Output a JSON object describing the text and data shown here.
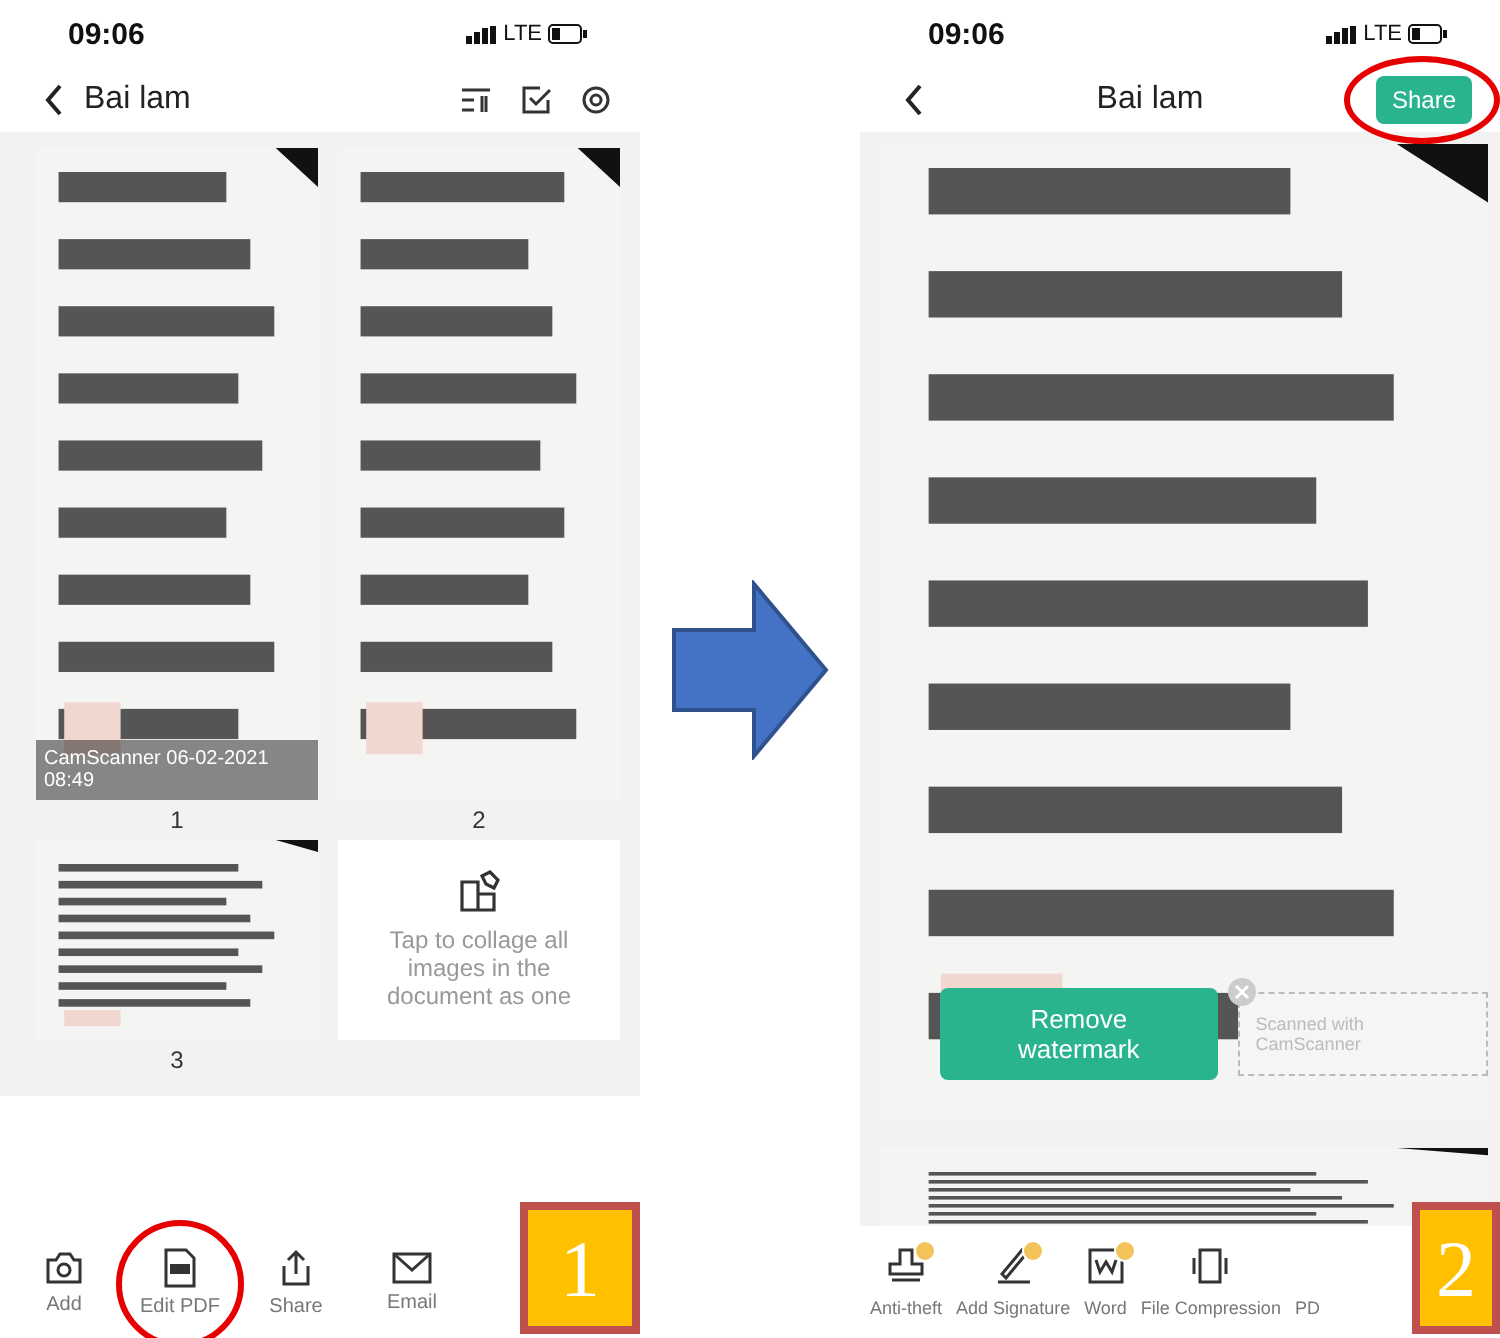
{
  "left_phone": {
    "status_bar": {
      "time": "09:06",
      "network": "LTE"
    },
    "nav": {
      "title": "Bai lam"
    },
    "pages": [
      {
        "number": "1",
        "caption": "CamScanner 06-02-2021 08:49"
      },
      {
        "number": "2"
      },
      {
        "number": "3"
      }
    ],
    "collage_hint": "Tap to collage all images in the document as one",
    "toolbar": [
      {
        "label": "Add",
        "highlighted": false
      },
      {
        "label": "Edit PDF",
        "highlighted": true
      },
      {
        "label": "Share",
        "highlighted": false
      },
      {
        "label": "Email",
        "highlighted": false
      }
    ],
    "badge": "1"
  },
  "right_phone": {
    "status_bar": {
      "time": "09:06",
      "network": "LTE"
    },
    "nav": {
      "title": "Bai lam"
    },
    "share_button": {
      "label": "Share",
      "highlighted": true
    },
    "watermark": {
      "button": "Remove watermark",
      "stamp": "Scanned with CamScanner"
    },
    "toolbar": [
      {
        "label": "Anti-theft",
        "premium": true
      },
      {
        "label": "Add Signature",
        "premium": true
      },
      {
        "label": "Word",
        "premium": true
      },
      {
        "label": "File Compression",
        "premium": false
      },
      {
        "label": "PD",
        "premium": false
      }
    ],
    "badge": "2"
  }
}
